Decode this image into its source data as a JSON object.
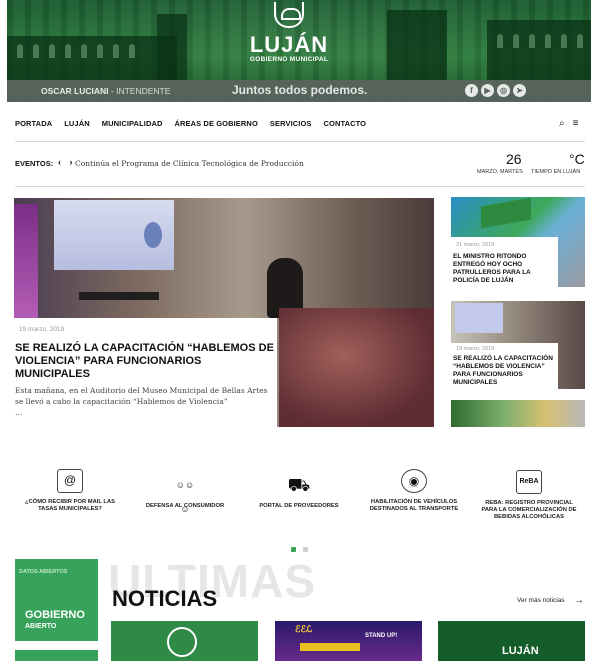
{
  "header": {
    "brand_title": "LUJÁN",
    "brand_subtitle": "GOBIERNO MUNICIPAL",
    "mayor_name": "OSCAR LUCIANI",
    "mayor_role": " - INTENDENTE",
    "slogan": "Juntos todos podemos.",
    "social": [
      {
        "icon": "facebook-icon",
        "glyph": "f"
      },
      {
        "icon": "youtube-icon",
        "glyph": "▶"
      },
      {
        "icon": "instagram-icon",
        "glyph": "◎"
      },
      {
        "icon": "telegram-icon",
        "glyph": "➤"
      }
    ]
  },
  "nav": {
    "items": [
      "PORTADA",
      "LUJÁN",
      "MUNICIPALIDAD",
      "ÁREAS DE GOBIERNO",
      "SERVICIOS",
      "CONTACTO"
    ],
    "search_glyph": "⌕",
    "menu_glyph": "≡"
  },
  "events": {
    "label": "EVENTOS:",
    "arrows": "‹ ›",
    "text": "Continúa el Programa de Clínica Tecnológica de Producción"
  },
  "weather": {
    "day": "26",
    "day_label": "MARZO, MARTES",
    "temp": "°C",
    "temp_label": "TIEMPO EN LUJÁN"
  },
  "hero": {
    "date": "19 marzo, 2019",
    "title": "SE REALIZÓ LA CAPACITACIÓN “HABLEMOS DE VIOLENCIA” PARA FUNCIONARIOS MUNICIPALES",
    "excerpt": "Esta mañana, en el Auditorio del Museo Municipal de Bellas Artes se llevó a cabo la capacitación “Hablemos de Violencia”",
    "more": "…"
  },
  "side_news": [
    {
      "date": "21 marzo, 2019",
      "title": "EL MINISTRO RITONDO ENTREGÓ HOY OCHO PATRULLEROS PARA LA POLICÍA DE LUJÁN"
    },
    {
      "date": "19 marzo, 2019",
      "title": "SE REALIZÓ LA CAPACITACIÓN “HABLEMOS DE VIOLENCIA” PARA FUNCIONARIOS MUNICIPALES"
    }
  ],
  "services": [
    {
      "icon": "email-icon",
      "glyph": "@",
      "label": "¿CÓMO RECIBIR POR MAIL LAS TASAS MUNICIPALES?"
    },
    {
      "icon": "people-icon",
      "glyph": "☺☺☺",
      "label": "DEFENSA AL CONSUMIDOR"
    },
    {
      "icon": "hand-truck-icon",
      "glyph": "⛟",
      "label": "PORTAL DE PROVEEDORES"
    },
    {
      "icon": "transport-icon",
      "glyph": "◉",
      "label": "HABILITACIÓN DE VEHÍCULOS DESTINADOS AL TRANSPORTE"
    },
    {
      "icon": "reba-icon",
      "glyph": "ReBA",
      "label": "REBA: REGISTRO PROVINCIAL PARA LA COMERCIALIZACIÓN DE BEBIDAS ALCOHÓLICAS"
    }
  ],
  "colors": {
    "brand_green": "#2e7d3e",
    "pager_active": "#37a35a",
    "pager_inactive": "#cfcfcf"
  },
  "bottom": {
    "datos_top": "DATOS ABIERTOS",
    "datos_big": "GOBIERNO",
    "datos_small": "ABIERTO",
    "ultimas": "ULTIMAS",
    "noticias": "NOTICIAS",
    "ver_mas": "Ver más noticias",
    "thumb2_title": "STAND UP!",
    "thumb3_title": "LUJÁN"
  }
}
